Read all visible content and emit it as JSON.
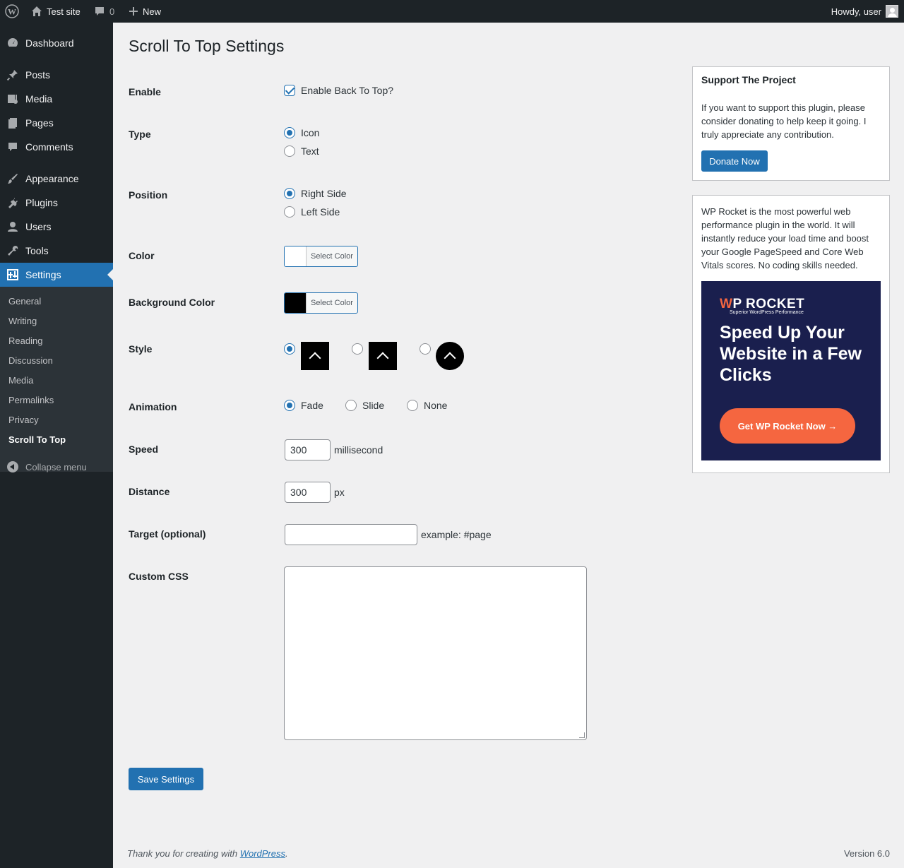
{
  "adminbar": {
    "site_name": "Test site",
    "comments_count": "0",
    "new_label": "New",
    "greeting": "Howdy, user"
  },
  "sidebar": {
    "items": [
      {
        "label": "Dashboard",
        "icon": "dashboard-icon"
      },
      {
        "label": "Posts",
        "icon": "pin-icon"
      },
      {
        "label": "Media",
        "icon": "media-icon"
      },
      {
        "label": "Pages",
        "icon": "pages-icon"
      },
      {
        "label": "Comments",
        "icon": "comment-icon"
      },
      {
        "label": "Appearance",
        "icon": "brush-icon"
      },
      {
        "label": "Plugins",
        "icon": "plug-icon"
      },
      {
        "label": "Users",
        "icon": "user-icon"
      },
      {
        "label": "Tools",
        "icon": "wrench-icon"
      },
      {
        "label": "Settings",
        "icon": "settings-icon"
      }
    ],
    "submenu": [
      "General",
      "Writing",
      "Reading",
      "Discussion",
      "Media",
      "Permalinks",
      "Privacy",
      "Scroll To Top"
    ],
    "collapse_label": "Collapse menu"
  },
  "main": {
    "title": "Scroll To Top Settings",
    "enable": {
      "label": "Enable",
      "option": "Enable Back To Top?",
      "checked": true
    },
    "type": {
      "label": "Type",
      "options": [
        "Icon",
        "Text"
      ],
      "selected": "Icon"
    },
    "position": {
      "label": "Position",
      "options": [
        "Right Side",
        "Left Side"
      ],
      "selected": "Right Side"
    },
    "color": {
      "label": "Color",
      "button": "Select Color",
      "value": "#ffffff"
    },
    "bg_color": {
      "label": "Background Color",
      "button": "Select Color",
      "value": "#000000"
    },
    "style": {
      "label": "Style",
      "selected_index": 0
    },
    "animation": {
      "label": "Animation",
      "options": [
        "Fade",
        "Slide",
        "None"
      ],
      "selected": "Fade"
    },
    "speed": {
      "label": "Speed",
      "value": "300",
      "unit": "millisecond"
    },
    "distance": {
      "label": "Distance",
      "value": "300",
      "unit": "px"
    },
    "target": {
      "label": "Target (optional)",
      "value": "",
      "hint": "example: #page"
    },
    "custom_css": {
      "label": "Custom CSS",
      "value": ""
    },
    "save_label": "Save Settings"
  },
  "support_box": {
    "title": "Support The Project",
    "text": "If you want to support this plugin, please consider donating to help keep it going. I truly appreciate any contribution.",
    "button": "Donate Now"
  },
  "promo_box": {
    "text": "WP Rocket is the most powerful web performance plugin in the world. It will instantly reduce your load time and boost your Google PageSpeed and Core Web Vitals scores. No coding skills needed.",
    "ad_logo_w": "W",
    "ad_logo_rest": "P ROCKET",
    "ad_tagline": "Superior WordPress Performance",
    "ad_headline": "Speed Up Your Website in a Few Clicks",
    "ad_cta": "Get WP Rocket Now →"
  },
  "footer": {
    "thanks_prefix": "Thank you for creating with ",
    "wp_link": "WordPress",
    "thanks_suffix": ".",
    "version": "Version 6.0"
  },
  "colors": {
    "accent": "#2271b1",
    "sidebar_bg": "#1d2327",
    "promo_bg": "#1a1f4e",
    "promo_cta": "#f56640"
  }
}
